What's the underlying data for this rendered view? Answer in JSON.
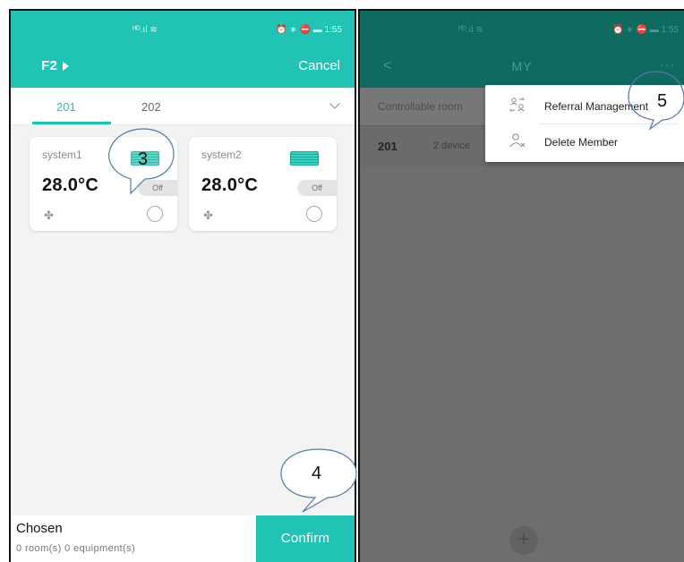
{
  "left": {
    "status": {
      "signal": "ᴴᴰ.ıl ≋",
      "right": "⏰ ∗ ⛔ ▬ 1:55"
    },
    "navbar": {
      "floor": "F2",
      "cancel": "Cancel"
    },
    "tabs": [
      {
        "label": "201",
        "active": true
      },
      {
        "label": "202",
        "active": false
      }
    ],
    "cards": [
      {
        "name": "system1",
        "temp": "28.0°C",
        "state": "Off"
      },
      {
        "name": "system2",
        "temp": "28.0°C",
        "state": "Off"
      }
    ],
    "footer": {
      "chosen": "Chosen",
      "counts": "0 room(s)   0 equipment(s)",
      "confirm": "Confirm"
    }
  },
  "right": {
    "status": {
      "signal": "ᴴᴰ.ıl ≋",
      "right": "⏰ ∗ ⛔ ▬ 1:55"
    },
    "navbar": {
      "back": "<",
      "title": "MY",
      "more": "···"
    },
    "subheader": "Controllable room",
    "room": {
      "name": "201",
      "devices": "2 device"
    },
    "popup": [
      {
        "icon": "referral-icon",
        "label": "Referral Management"
      },
      {
        "icon": "delete-member-icon",
        "label": "Delete Member"
      }
    ],
    "add": "+"
  },
  "callouts": [
    {
      "label": "3"
    },
    {
      "label": "4"
    },
    {
      "label": "5"
    }
  ],
  "colors": {
    "teal": "#21c4b4",
    "teal_dimmed": "#0f6a60",
    "overlay_gray": "#6e6e6e"
  }
}
